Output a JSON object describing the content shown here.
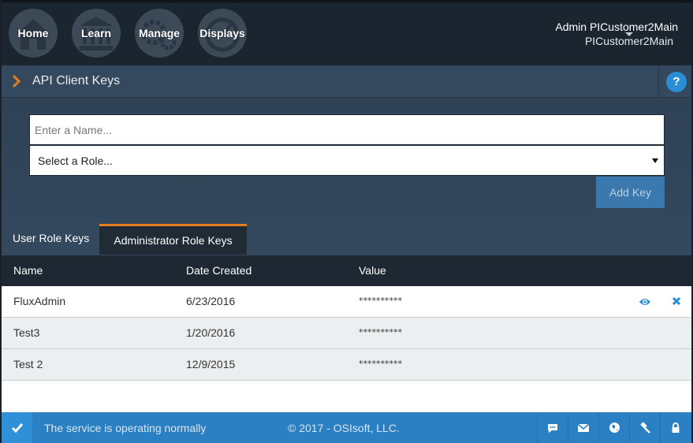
{
  "nav": {
    "items": [
      {
        "label": "Home",
        "icon": "house-icon"
      },
      {
        "label": "Learn",
        "icon": "bank-icon"
      },
      {
        "label": "Manage",
        "icon": "gears-icon"
      },
      {
        "label": "Displays",
        "icon": "gauge-icon"
      }
    ],
    "user_name": "Admin PICustomer2Main",
    "tenant": "PICustomer2Main"
  },
  "page": {
    "title": "API Client Keys",
    "help_label": "?"
  },
  "form": {
    "name_placeholder": "Enter a Name...",
    "name_value": "",
    "role_selected": "Select a Role...",
    "add_label": "Add Key"
  },
  "tabs": [
    {
      "label": "User Role Keys",
      "active": false
    },
    {
      "label": "Administrator Role Keys",
      "active": true
    }
  ],
  "table": {
    "columns": [
      "Name",
      "Date Created",
      "Value"
    ],
    "rows": [
      {
        "name": "FluxAdmin",
        "date": "6/23/2016",
        "value": "**********",
        "actions": true
      },
      {
        "name": "Test3",
        "date": "1/20/2016",
        "value": "**********",
        "actions": false
      },
      {
        "name": "Test 2",
        "date": "12/9/2015",
        "value": "**********",
        "actions": false
      }
    ]
  },
  "footer": {
    "status": "The service is operating normally",
    "copyright": "© 2017 - OSIsoft, LLC.",
    "icons": [
      "chat-icon",
      "mail-icon",
      "globe-icon",
      "gavel-icon",
      "lock-icon"
    ]
  },
  "colors": {
    "accent": "#e67e22",
    "nav_bg": "#1b2530",
    "header_bg": "#34495e",
    "footer_bg": "#2b7fc3",
    "link_blue": "#2b8dd6"
  }
}
